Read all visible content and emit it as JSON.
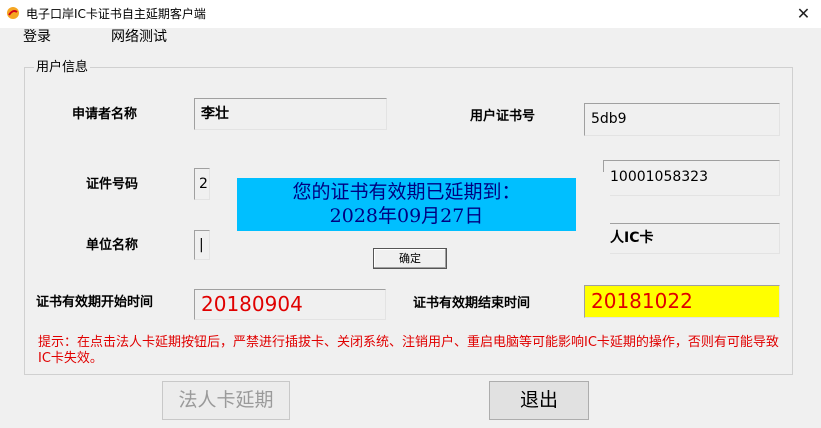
{
  "window": {
    "title": "电子口岸IC卡证书自主延期客户端",
    "close_glyph": "✕"
  },
  "menu": {
    "items": [
      "登录",
      "网络测试"
    ]
  },
  "group": {
    "title": "用户信息"
  },
  "fields": {
    "applicant_name_label": "申请者名称",
    "applicant_name_value": "李壮",
    "user_cert_no_label": "用户证书号",
    "user_cert_no_value": "5db9",
    "id_number_label": "证件号码",
    "id_number_value": "2",
    "card_number_value": "10001058323",
    "unit_name_label": "单位名称",
    "unit_name_value": "|",
    "card_type_value": "人IC卡",
    "valid_start_label": "证书有效期开始时间",
    "valid_start_value": "20180904",
    "valid_end_label": "证书有效期结束时间",
    "valid_end_value": "20181022"
  },
  "tip": "提示：在点击法人卡延期按钮后，严禁进行插拔卡、关闭系统、注销用户、重启电脑等可能影响IC卡延期的操作，否则有可能导致IC卡失效。",
  "dialog": {
    "line1": "您的证书有效期已延期到：",
    "line2": "2028年09月27日",
    "ok_label": "确定"
  },
  "buttons": {
    "extend_label": "法人卡延期",
    "exit_label": "退出"
  }
}
